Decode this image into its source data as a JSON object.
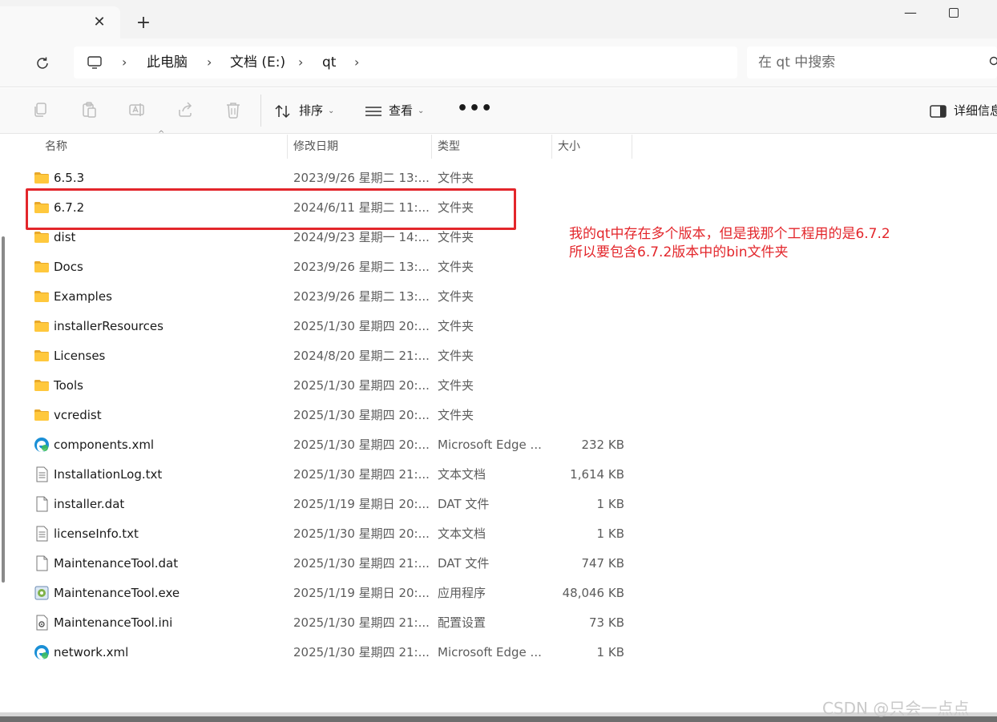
{
  "tabbar": {
    "close_glyph": "✕",
    "new_tab_glyph": "+",
    "minimize_glyph": "—"
  },
  "address": {
    "crumbs": [
      "此电脑",
      "文档 (E:)",
      "qt"
    ],
    "search_placeholder": "在 qt 中搜索"
  },
  "toolbar": {
    "sort_label": "排序",
    "view_label": "查看",
    "more_label": "•••",
    "details_label": "详细信息"
  },
  "columns": {
    "name": "名称",
    "date": "修改日期",
    "type": "类型",
    "size": "大小"
  },
  "rows": [
    {
      "icon": "folder-icon",
      "name": "6.5.3",
      "date": "2023/9/26 星期二 13:...",
      "type": "文件夹",
      "size": ""
    },
    {
      "icon": "folder-icon",
      "name": "6.7.2",
      "date": "2024/6/11 星期二 11:...",
      "type": "文件夹",
      "size": ""
    },
    {
      "icon": "folder-icon",
      "name": "dist",
      "date": "2024/9/23 星期一 14:...",
      "type": "文件夹",
      "size": ""
    },
    {
      "icon": "folder-icon",
      "name": "Docs",
      "date": "2023/9/26 星期二 13:...",
      "type": "文件夹",
      "size": ""
    },
    {
      "icon": "folder-icon",
      "name": "Examples",
      "date": "2023/9/26 星期二 13:...",
      "type": "文件夹",
      "size": ""
    },
    {
      "icon": "folder-icon",
      "name": "installerResources",
      "date": "2025/1/30 星期四 20:...",
      "type": "文件夹",
      "size": ""
    },
    {
      "icon": "folder-icon",
      "name": "Licenses",
      "date": "2024/8/20 星期二 21:...",
      "type": "文件夹",
      "size": ""
    },
    {
      "icon": "folder-icon",
      "name": "Tools",
      "date": "2025/1/30 星期四 20:...",
      "type": "文件夹",
      "size": ""
    },
    {
      "icon": "folder-icon",
      "name": "vcredist",
      "date": "2025/1/30 星期四 20:...",
      "type": "文件夹",
      "size": ""
    },
    {
      "icon": "edge-icon",
      "name": "components.xml",
      "date": "2025/1/30 星期四 20:...",
      "type": "Microsoft Edge ...",
      "size": "232 KB"
    },
    {
      "icon": "text-file-icon",
      "name": "InstallationLog.txt",
      "date": "2025/1/30 星期四 21:...",
      "type": "文本文档",
      "size": "1,614 KB"
    },
    {
      "icon": "blank-file-icon",
      "name": "installer.dat",
      "date": "2025/1/19 星期日 20:...",
      "type": "DAT 文件",
      "size": "1 KB"
    },
    {
      "icon": "text-file-icon",
      "name": "licenseInfo.txt",
      "date": "2025/1/30 星期四 20:...",
      "type": "文本文档",
      "size": "1 KB"
    },
    {
      "icon": "blank-file-icon",
      "name": "MaintenanceTool.dat",
      "date": "2025/1/30 星期四 21:...",
      "type": "DAT 文件",
      "size": "747 KB"
    },
    {
      "icon": "exe-icon",
      "name": "MaintenanceTool.exe",
      "date": "2025/1/19 星期日 20:...",
      "type": "应用程序",
      "size": "48,046 KB"
    },
    {
      "icon": "ini-file-icon",
      "name": "MaintenanceTool.ini",
      "date": "2025/1/30 星期四 21:...",
      "type": "配置设置",
      "size": "73 KB"
    },
    {
      "icon": "edge-icon",
      "name": "network.xml",
      "date": "2025/1/30 星期四 21:...",
      "type": "Microsoft Edge ...",
      "size": "1 KB"
    }
  ],
  "annotation": {
    "line1": "我的qt中存在多个版本，但是我那个工程用的是6.7.2",
    "line2": "所以要包含6.7.2版本中的bin文件夹",
    "color": "#e3262b"
  },
  "watermark": "CSDN @只会一点点"
}
